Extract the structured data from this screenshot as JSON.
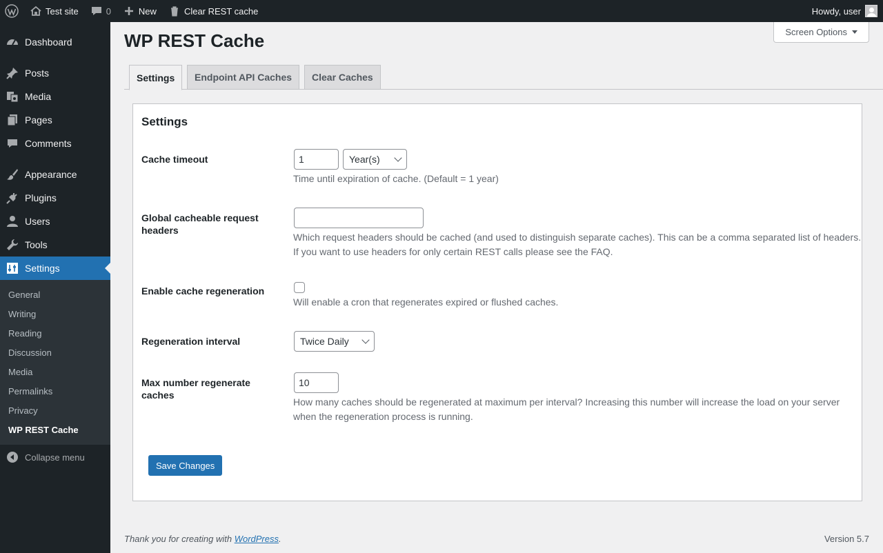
{
  "adminbar": {
    "site_name": "Test site",
    "comments_count": "0",
    "new_label": "New",
    "clear_cache_label": "Clear REST cache",
    "howdy": "Howdy, user"
  },
  "sidebar": {
    "items": [
      {
        "label": "Dashboard",
        "icon": "dashboard-icon"
      },
      {
        "label": "Posts",
        "icon": "pin-icon"
      },
      {
        "label": "Media",
        "icon": "media-icon"
      },
      {
        "label": "Pages",
        "icon": "pages-icon"
      },
      {
        "label": "Comments",
        "icon": "comment-icon"
      },
      {
        "label": "Appearance",
        "icon": "brush-icon"
      },
      {
        "label": "Plugins",
        "icon": "plug-icon"
      },
      {
        "label": "Users",
        "icon": "user-icon"
      },
      {
        "label": "Tools",
        "icon": "wrench-icon"
      },
      {
        "label": "Settings",
        "icon": "sliders-icon"
      }
    ],
    "submenu": [
      "General",
      "Writing",
      "Reading",
      "Discussion",
      "Media",
      "Permalinks",
      "Privacy",
      "WP REST Cache"
    ],
    "collapse_label": "Collapse menu"
  },
  "header": {
    "screen_options": "Screen Options",
    "title": "WP REST Cache"
  },
  "tabs": [
    "Settings",
    "Endpoint API Caches",
    "Clear Caches"
  ],
  "panel": {
    "title": "Settings",
    "cache_timeout": {
      "label": "Cache timeout",
      "value": "1",
      "unit": "Year(s)",
      "description": "Time until expiration of cache. (Default = 1 year)"
    },
    "global_headers": {
      "label": "Global cacheable request headers",
      "value": "",
      "description_line1": "Which request headers should be cached (and used to distinguish separate caches). This can be a comma separated list of headers.",
      "description_line2": "If you want to use headers for only certain REST calls please see the FAQ."
    },
    "regeneration": {
      "label": "Enable cache regeneration",
      "checked": false,
      "description": "Will enable a cron that regenerates expired or flushed caches."
    },
    "interval": {
      "label": "Regeneration interval",
      "value": "Twice Daily"
    },
    "max_regenerate": {
      "label": "Max number regenerate caches",
      "value": "10",
      "description_line1": "How many caches should be regenerated at maximum per interval? Increasing this number will increase the load on your server",
      "description_line2": "when the regeneration process is running."
    },
    "save_label": "Save Changes"
  },
  "footer": {
    "thanks_prefix": "Thank you for creating with ",
    "thanks_link": "WordPress",
    "thanks_suffix": ".",
    "version": "Version 5.7"
  },
  "colors": {
    "accent": "#2271b1",
    "admin_dark": "#1d2327"
  }
}
